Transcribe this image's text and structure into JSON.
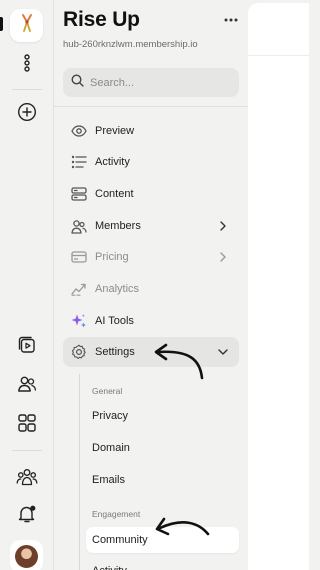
{
  "rail": {
    "app_icon": "community-logo-icon",
    "items": [
      {
        "icon": "more-vertical-icon"
      },
      {
        "icon": "add-circle-icon"
      },
      {
        "icon": "video-library-icon"
      },
      {
        "icon": "members-icon"
      },
      {
        "icon": "apps-grid-icon"
      },
      {
        "icon": "people-group-icon"
      },
      {
        "icon": "notification-bell-icon"
      }
    ]
  },
  "sidebar": {
    "title": "Rise Up",
    "url": "hub-260rknzlwm.membership.io",
    "search": {
      "placeholder": "Search...",
      "value": ""
    },
    "nav": [
      {
        "label": "Preview",
        "icon": "eye-icon"
      },
      {
        "label": "Activity",
        "icon": "activity-list-icon"
      },
      {
        "label": "Content",
        "icon": "content-stack-icon"
      },
      {
        "label": "Members",
        "icon": "members-icon",
        "has_chevron": true
      },
      {
        "label": "Pricing",
        "icon": "credit-card-icon",
        "has_chevron": true,
        "muted": true
      },
      {
        "label": "Analytics",
        "icon": "analytics-trend-icon",
        "muted": true
      },
      {
        "label": "AI Tools",
        "icon": "sparkles-icon"
      },
      {
        "label": "Settings",
        "icon": "gear-icon",
        "expanded": true
      }
    ],
    "settings_sections": [
      {
        "heading": "General",
        "items": [
          "Privacy",
          "Domain",
          "Emails"
        ]
      },
      {
        "heading": "Engagement",
        "items": [
          "Community",
          "Activity"
        ]
      }
    ],
    "active_subitem": "Community"
  },
  "colors": {
    "background": "#f2f2f1",
    "selected": "#e5e5e3",
    "ai_accent": "#8b5cf6",
    "annotation_arrow": "#111111"
  }
}
